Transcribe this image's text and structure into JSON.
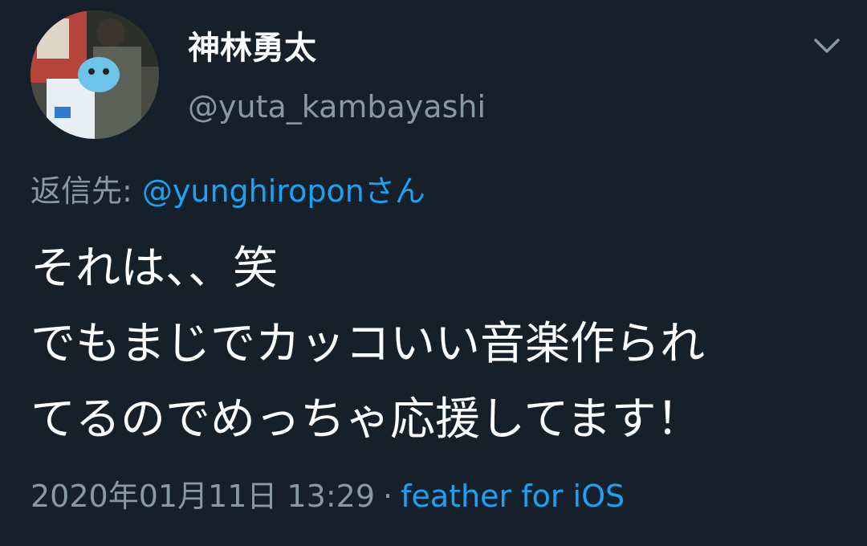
{
  "tweet": {
    "author": {
      "display_name": "神林勇太",
      "handle": "@yuta_kambayashi"
    },
    "menu_icon": "chevron-down-icon",
    "reply": {
      "prefix": "返信先: ",
      "mention": "@yunghiropon",
      "suffix": "さん"
    },
    "body_lines": [
      "それは、、笑",
      "でもまじでカッコいい音楽作られ",
      "てるのでめっちゃ応援してます！"
    ],
    "timestamp": "2020年01月11日 13:29",
    "separator": "·",
    "source": "feather for iOS"
  },
  "colors": {
    "background": "#15202b",
    "primary_text": "#ffffff",
    "secondary_text": "#8899a6",
    "link": "#1da1f2"
  }
}
